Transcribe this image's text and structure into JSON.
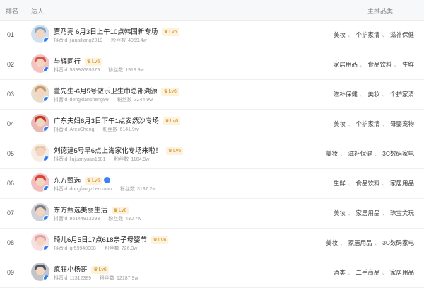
{
  "header": {
    "rank": "排名",
    "talent": "达人",
    "category": "主推品类"
  },
  "meta_labels": {
    "douyin_id": "抖音id",
    "fans": "粉丝数"
  },
  "rows": [
    {
      "rank": "01",
      "name": "贾乃亮 6月3日上午10点韩国新专场",
      "level": "Lv6",
      "douyin_id": "jianailiang2019",
      "fans": "4059.4w",
      "cats": [
        "美妆",
        "个护家清",
        "滋补保健"
      ],
      "avatar_color": "#7fa9c8"
    },
    {
      "rank": "02",
      "name": "与辉同行",
      "level": "Lv6",
      "douyin_id": "58997689379",
      "fans": "1919.9w",
      "cats": [
        "家居用品",
        "食品饮料",
        "生鲜"
      ],
      "avatar_color": "#d9544d"
    },
    {
      "rank": "03",
      "name": "董先生-6月5号做乐卫生巾总部溯源",
      "level": "Lv6",
      "douyin_id": "dongxiansheng99",
      "fans": "3244.9w",
      "cats": [
        "滋补保健",
        "美妆",
        "个护家清"
      ],
      "avatar_color": "#c49b6a"
    },
    {
      "rank": "04",
      "name": "广东夫妇6月3日下午1点安然沙专场",
      "level": "Lv6",
      "douyin_id": "AresCheng",
      "fans": "6141.9w",
      "cats": [
        "美妆",
        "个护家清",
        "母婴宠物"
      ],
      "avatar_color": "#c0392b"
    },
    {
      "rank": "05",
      "name": "刘德建5号早6点上海家化专场来啦！",
      "level": "Lv6",
      "douyin_id": "liujuanyuan1681",
      "fans": "1164.9w",
      "cats": [
        "美妆",
        "滋补保健",
        "3C数码家电"
      ],
      "avatar_color": "#e6c9a8"
    },
    {
      "rank": "06",
      "name": "东方甄选",
      "level": "Lv6",
      "douyin_id": "dongfangzhenxuan",
      "fans": "3137.2w",
      "cats": [
        "生鲜",
        "食品饮料",
        "家居用品"
      ],
      "avatar_color": "#d64541"
    },
    {
      "rank": "07",
      "name": "东方甄选美丽生活",
      "level": "Lv6",
      "douyin_id": "95144813293",
      "fans": "430.7w",
      "cats": [
        "美妆",
        "家居用品",
        "珠宝文玩"
      ],
      "avatar_color": "#7a7f86"
    },
    {
      "rank": "08",
      "name": "琦儿6月5日17点618亲子母婴节",
      "level": "Lv6",
      "douyin_id": "qr59940008",
      "fans": "726.3w",
      "cats": [
        "美妆",
        "家居用品",
        "3C数码家电"
      ],
      "avatar_color": "#e8a0a8"
    },
    {
      "rank": "09",
      "name": "疯狂小杨哥",
      "level": "Lv6",
      "douyin_id": "11312389",
      "fans": "12187.9w",
      "cats": [
        "酒类",
        "二手商品",
        "家居用品"
      ],
      "avatar_color": "#4d5560"
    }
  ]
}
